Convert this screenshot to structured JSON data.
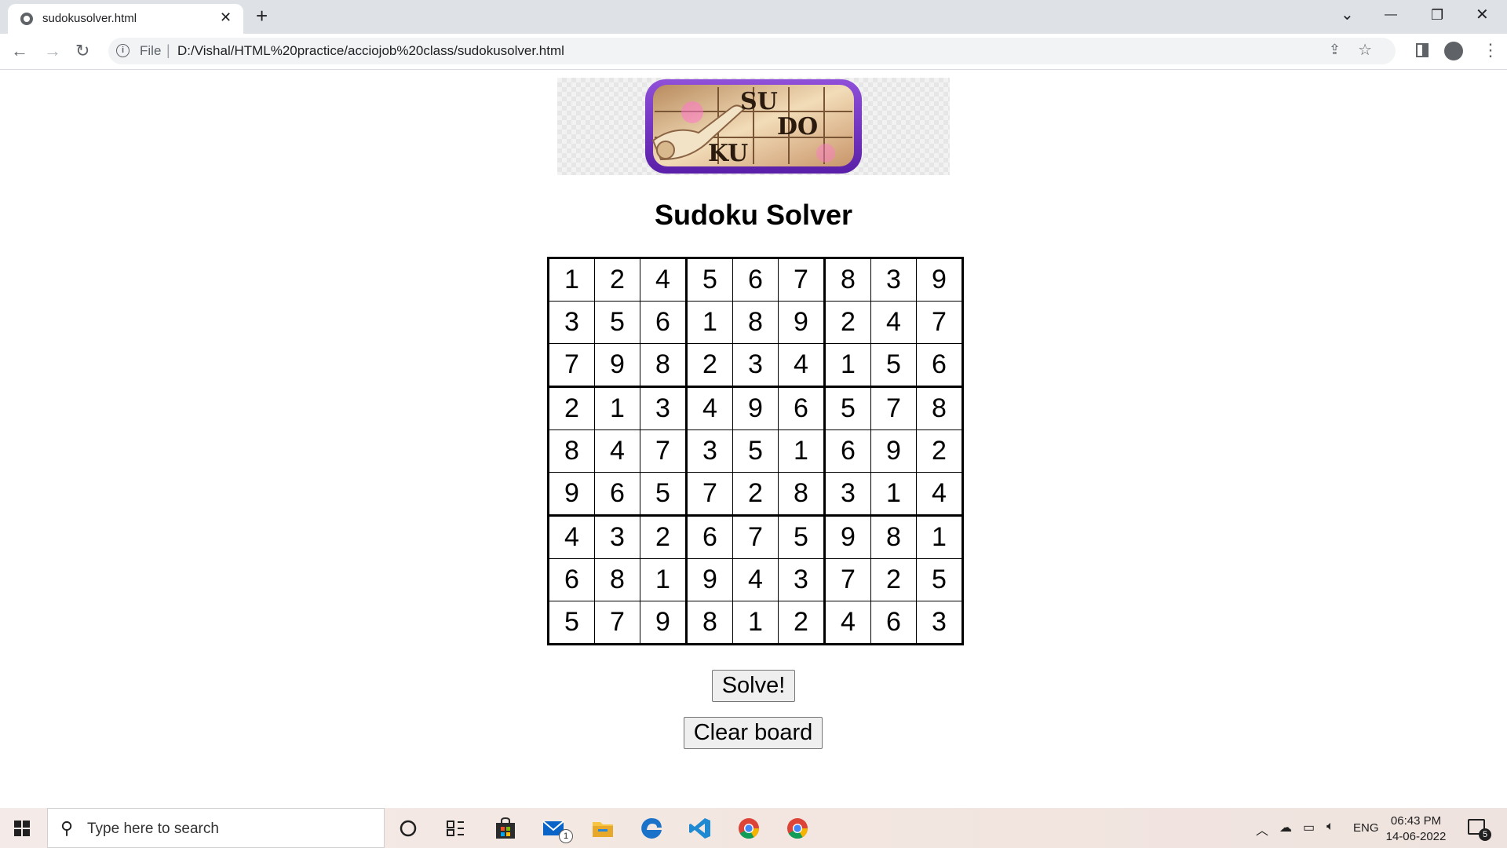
{
  "browser": {
    "tab_title": "sudokusolver.html",
    "tab_close": "✕",
    "new_tab": "+",
    "window_controls": {
      "dropdown": "⌄",
      "minimize": "—",
      "restore": "❐",
      "close": "✕"
    },
    "address": {
      "scheme_label": "File",
      "separator": "|",
      "url": "D:/Vishal/HTML%20practice/acciojob%20class/sudokusolver.html"
    }
  },
  "page": {
    "logo_letters": {
      "row1": "SU",
      "row2": "DO",
      "row3": "KU"
    },
    "title": "Sudoku Solver",
    "board": [
      [
        "1",
        "2",
        "4",
        "5",
        "6",
        "7",
        "8",
        "3",
        "9"
      ],
      [
        "3",
        "5",
        "6",
        "1",
        "8",
        "9",
        "2",
        "4",
        "7"
      ],
      [
        "7",
        "9",
        "8",
        "2",
        "3",
        "4",
        "1",
        "5",
        "6"
      ],
      [
        "2",
        "1",
        "3",
        "4",
        "9",
        "6",
        "5",
        "7",
        "8"
      ],
      [
        "8",
        "4",
        "7",
        "3",
        "5",
        "1",
        "6",
        "9",
        "2"
      ],
      [
        "9",
        "6",
        "5",
        "7",
        "2",
        "8",
        "3",
        "1",
        "4"
      ],
      [
        "4",
        "3",
        "2",
        "6",
        "7",
        "5",
        "9",
        "8",
        "1"
      ],
      [
        "6",
        "8",
        "1",
        "9",
        "4",
        "3",
        "7",
        "2",
        "5"
      ],
      [
        "5",
        "7",
        "9",
        "8",
        "1",
        "2",
        "4",
        "6",
        "3"
      ]
    ],
    "solve_label": "Solve!",
    "clear_label": "Clear board"
  },
  "taskbar": {
    "search_placeholder": "Type here to search",
    "mail_badge": "1",
    "tray": {
      "language": "ENG"
    },
    "clock": {
      "time": "06:43 PM",
      "date": "14-06-2022"
    },
    "notification_count": "5"
  }
}
